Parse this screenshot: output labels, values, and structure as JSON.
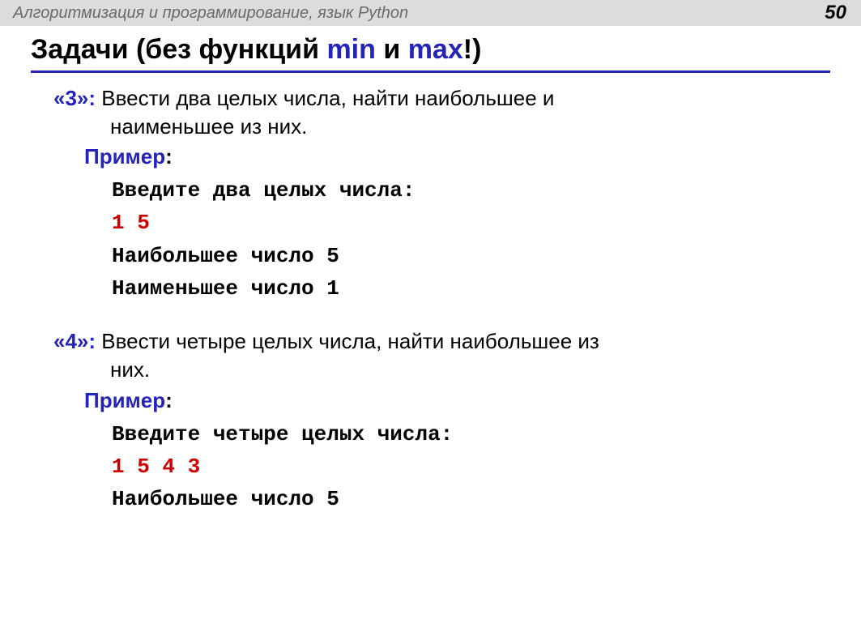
{
  "header": {
    "subject": "Алгоритмизация и программирование, язык Python",
    "pageNumber": "50"
  },
  "title": {
    "prefix": "Задачи (без функций ",
    "func1": "min",
    "and": " и ",
    "func2": "max",
    "suffix": "!)"
  },
  "task3": {
    "grade": "«3»:",
    "line1": " Ввести два целых числа, найти наибольшее и",
    "line2": "наименьшее из них.",
    "exampleLabel": "Пример",
    "colon": ":",
    "code": {
      "prompt": "Введите два целых числа:",
      "input": "1 5",
      "out1": "Наибольшее число 5",
      "out2": "Наименьшее число 1"
    }
  },
  "task4": {
    "grade": "«4»:",
    "line1": " Ввести четыре целых числа, найти наибольшее из",
    "line2": "них.",
    "exampleLabel": "Пример",
    "colon": ":",
    "code": {
      "prompt": "Введите четыре целых числа:",
      "input": "1 5 4 3",
      "out1": "Наибольшее число 5"
    }
  }
}
